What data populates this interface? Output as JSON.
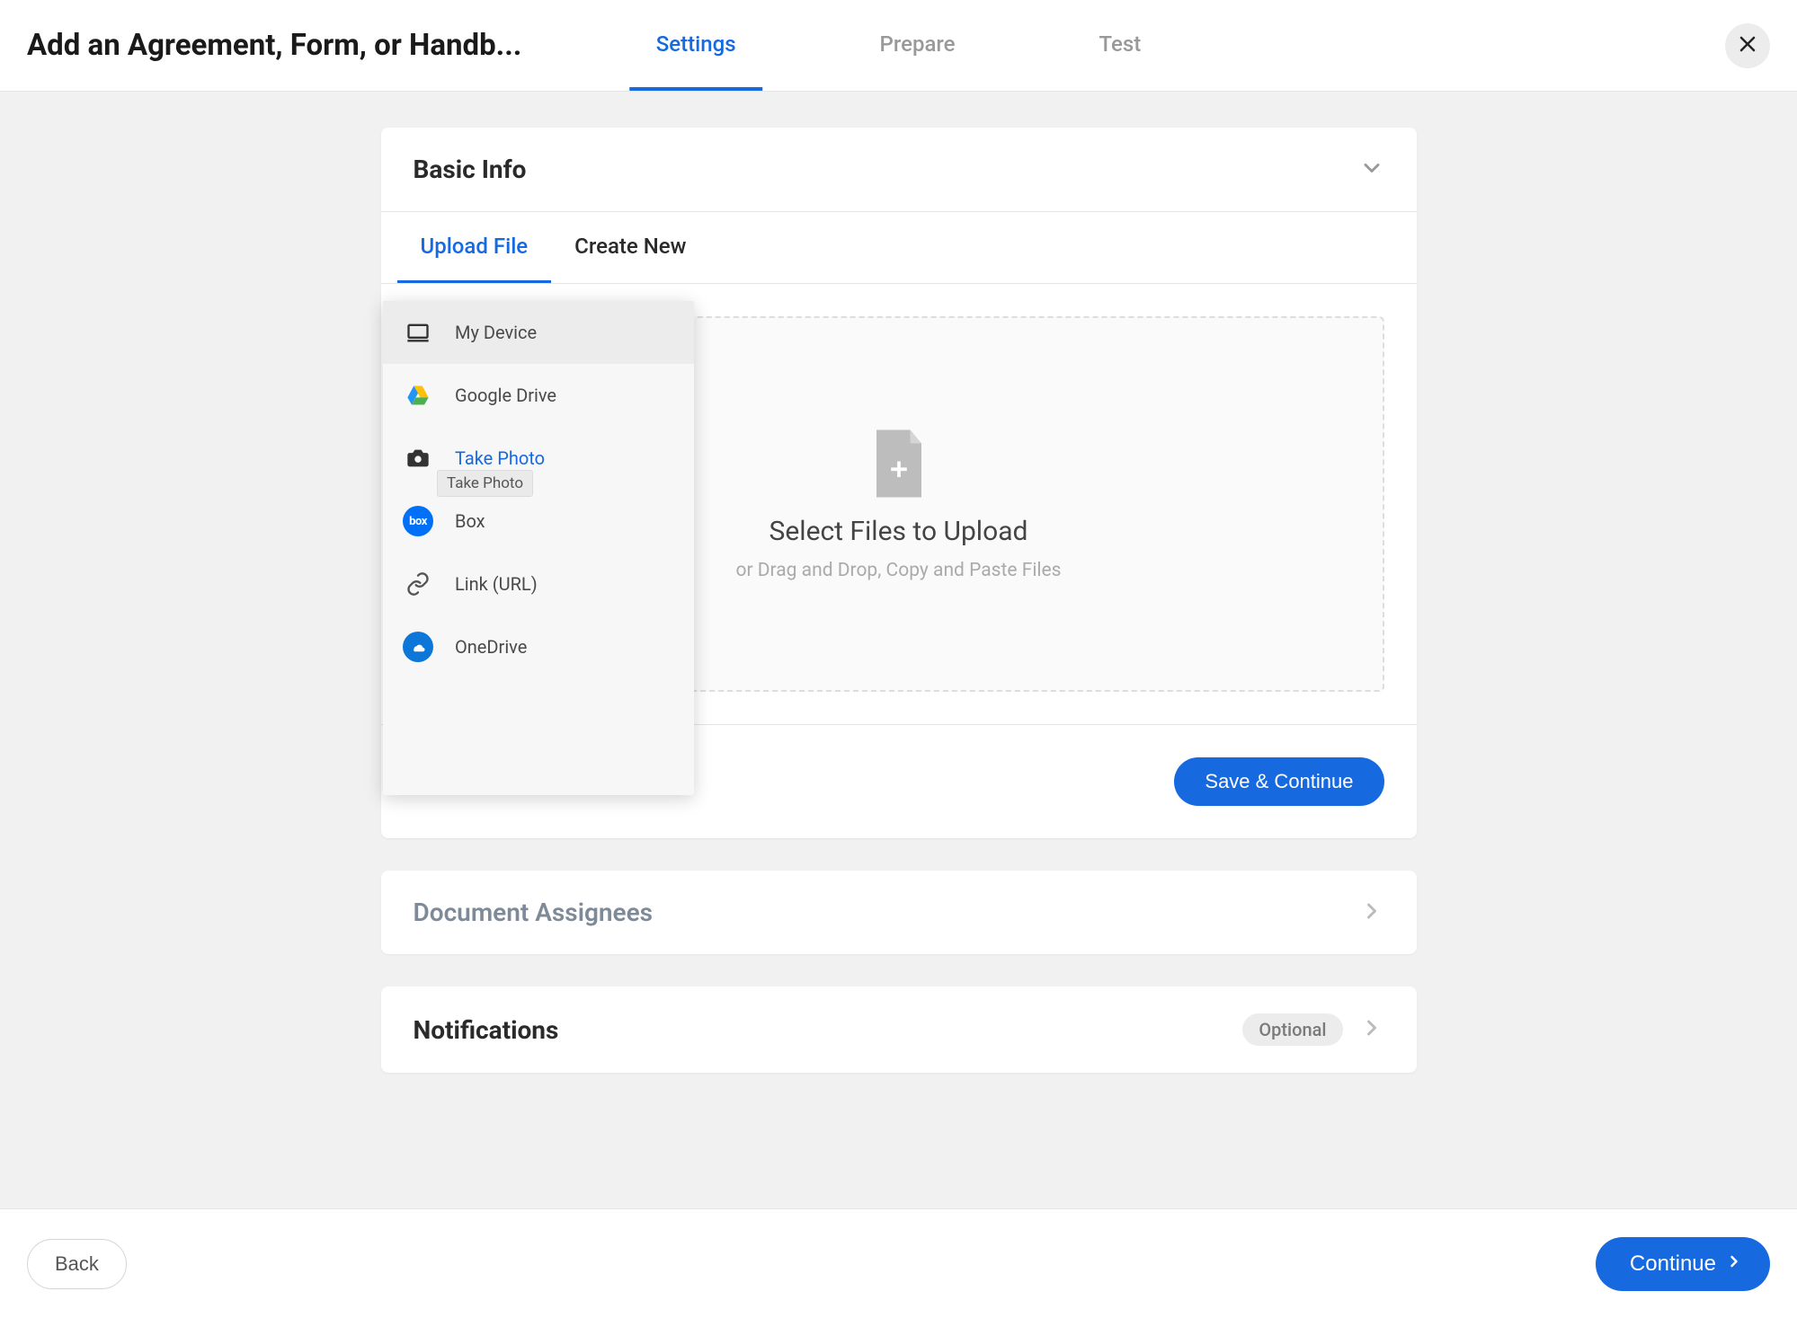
{
  "header": {
    "title": "Add an Agreement, Form, or Handb...",
    "tabs": [
      {
        "label": "Settings",
        "active": true
      },
      {
        "label": "Prepare",
        "active": false
      },
      {
        "label": "Test",
        "active": false
      }
    ]
  },
  "basic_info": {
    "title": "Basic Info",
    "sub_tabs": [
      {
        "label": "Upload File",
        "active": true
      },
      {
        "label": "Create New",
        "active": false
      }
    ],
    "dropzone": {
      "title": "Select Files to Upload",
      "subtitle": "or Drag and Drop, Copy and Paste Files"
    },
    "save_button": "Save & Continue"
  },
  "upload_sources": {
    "items": [
      {
        "id": "my-device",
        "label": "My Device",
        "selected": true
      },
      {
        "id": "google-drive",
        "label": "Google Drive"
      },
      {
        "id": "take-photo",
        "label": "Take Photo",
        "link_style": true,
        "tooltip": "Take Photo"
      },
      {
        "id": "box",
        "label": "Box"
      },
      {
        "id": "link-url",
        "label": "Link (URL)"
      },
      {
        "id": "onedrive",
        "label": "OneDrive"
      }
    ]
  },
  "document_assignees": {
    "title": "Document Assignees"
  },
  "notifications": {
    "title": "Notifications",
    "badge": "Optional"
  },
  "footer": {
    "back": "Back",
    "continue": "Continue"
  }
}
